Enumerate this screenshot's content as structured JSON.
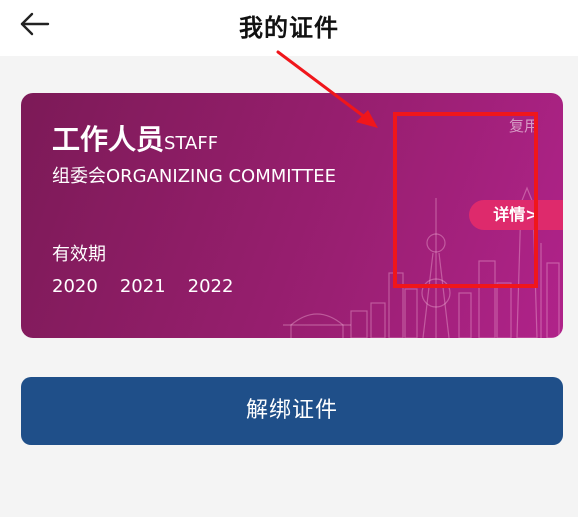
{
  "header": {
    "title": "我的证件",
    "back_icon": "back-arrow-icon"
  },
  "card": {
    "role_cn": "工作人员",
    "role_en": "STAFF",
    "org": "组委会ORGANIZING COMMITTEE",
    "validity_label": "有效期",
    "years": [
      "2020",
      "2021",
      "2022"
    ],
    "reuse_label": "复用",
    "details_label": "详情>",
    "colors": {
      "gradient_start": "#7c1a57",
      "gradient_end": "#b0238a",
      "details_button": "#de2a6c"
    }
  },
  "annotation": {
    "color": "#f0161b"
  },
  "actions": {
    "unbind_label": "解绑证件",
    "unbind_color": "#1f4f89"
  }
}
